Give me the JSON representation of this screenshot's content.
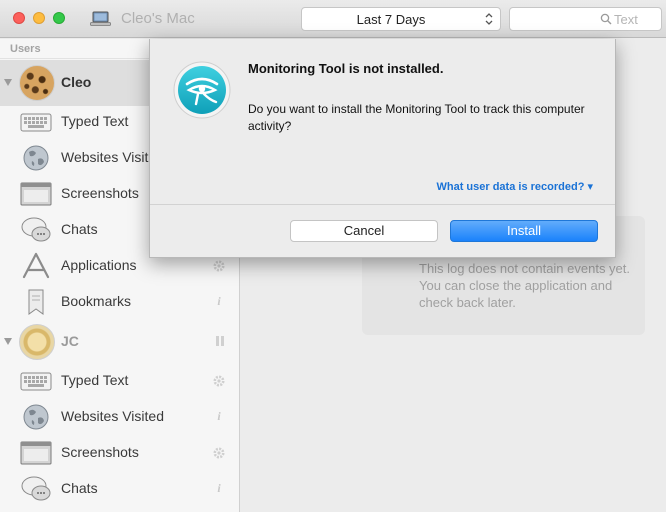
{
  "window": {
    "computer_name": "Cleo's Mac",
    "computer_icon": "laptop-icon"
  },
  "toolbar": {
    "range_value": "Last 7 Days",
    "search_placeholder": "Text"
  },
  "sidebar": {
    "header": "Users",
    "users": [
      {
        "name": "Cleo",
        "selected": true,
        "items": [
          {
            "label": "Typed Text",
            "icon": "keyboard-icon",
            "status": ""
          },
          {
            "label": "Websites Visited",
            "icon": "globe-icon",
            "status": ""
          },
          {
            "label": "Screenshots",
            "icon": "screenshots-icon",
            "status": ""
          },
          {
            "label": "Chats",
            "icon": "chat-bubble-icon",
            "status": ""
          },
          {
            "label": "Applications",
            "icon": "applications-icon",
            "status": "gear"
          },
          {
            "label": "Bookmarks",
            "icon": "bookmark-icon",
            "status": "i"
          }
        ]
      },
      {
        "name": "JC",
        "selected": false,
        "status": "paused",
        "items": [
          {
            "label": "Typed Text",
            "icon": "keyboard-icon",
            "status": "gear"
          },
          {
            "label": "Websites Visited",
            "icon": "globe-icon",
            "status": "i"
          },
          {
            "label": "Screenshots",
            "icon": "screenshots-icon",
            "status": "gear"
          },
          {
            "label": "Chats",
            "icon": "chat-bubble-icon",
            "status": "i"
          }
        ]
      }
    ]
  },
  "main": {
    "empty_message": "This log does not contain events yet. You can close the application and check back later."
  },
  "dialog": {
    "title": "Monitoring Tool is not installed.",
    "message": "Do you want to install the Monitoring Tool to track this computer activity?",
    "link": "What user data is recorded? ▾",
    "cancel_label": "Cancel",
    "install_label": "Install",
    "icon": "eye-of-horus-app-icon"
  },
  "colors": {
    "accent": "#1a82fb",
    "link": "#1a72d6",
    "app_icon": "#1cb3c8"
  }
}
